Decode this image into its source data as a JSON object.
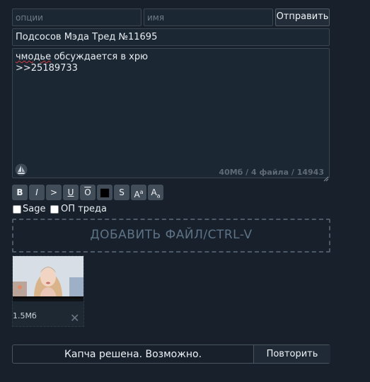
{
  "form": {
    "options_placeholder": "опции",
    "name_placeholder": "имя",
    "send_label": "Отправить",
    "subject_value": "Подсосов Мэда Тред №11695",
    "comment_line1_misspelled": "чмодье",
    "comment_line1_rest": " обсуждается в хрю",
    "comment_line2": ">>25189733",
    "counter": "40Мб / 4 файла / 14943",
    "format_buttons": [
      "B",
      "I",
      ">",
      "U",
      "O",
      "■",
      "S",
      "A",
      "a",
      "A",
      "a"
    ],
    "sage_label": "Sage",
    "op_label": "ОП треда",
    "dropzone_label": "ДОБАВИТЬ ФАЙЛ/CTRL-V"
  },
  "attachment": {
    "size": "1.5Мб",
    "remove_icon": "close-icon"
  },
  "captcha": {
    "status_text": "Капча решена. Возможно.",
    "retry_label": "Повторить"
  }
}
